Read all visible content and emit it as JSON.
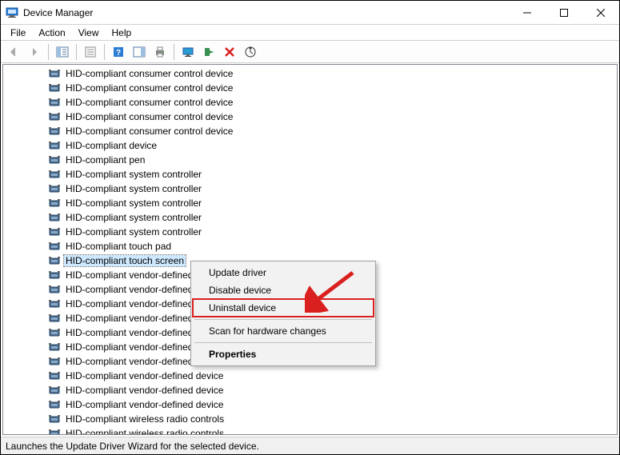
{
  "window": {
    "title": "Device Manager"
  },
  "menubar": {
    "file": "File",
    "action": "Action",
    "view": "View",
    "help": "Help"
  },
  "toolbar_tooltips": {
    "back": "Back",
    "forward": "Forward",
    "show_hide_tree": "Show/Hide Console Tree",
    "properties": "Properties",
    "help": "Help",
    "action_pane": "Show/Hide Action Pane",
    "print": "Print",
    "monitor": "Scan monitor",
    "scan": "Scan for hardware changes",
    "uninstall": "Uninstall device",
    "enable": "Enable device"
  },
  "devices": [
    "HID-compliant consumer control device",
    "HID-compliant consumer control device",
    "HID-compliant consumer control device",
    "HID-compliant consumer control device",
    "HID-compliant consumer control device",
    "HID-compliant device",
    "HID-compliant pen",
    "HID-compliant system controller",
    "HID-compliant system controller",
    "HID-compliant system controller",
    "HID-compliant system controller",
    "HID-compliant system controller",
    "HID-compliant touch pad",
    "HID-compliant touch screen",
    "HID-compliant vendor-defined device",
    "HID-compliant vendor-defined device",
    "HID-compliant vendor-defined device",
    "HID-compliant vendor-defined device",
    "HID-compliant vendor-defined device",
    "HID-compliant vendor-defined device",
    "HID-compliant vendor-defined device",
    "HID-compliant vendor-defined device",
    "HID-compliant vendor-defined device",
    "HID-compliant vendor-defined device",
    "HID-compliant wireless radio controls",
    "HID-compliant wireless radio controls"
  ],
  "selected_index": 13,
  "context_menu": {
    "update": "Update driver",
    "disable": "Disable device",
    "uninstall": "Uninstall device",
    "scan": "Scan for hardware changes",
    "properties": "Properties"
  },
  "statusbar": {
    "text": "Launches the Update Driver Wizard for the selected device."
  }
}
